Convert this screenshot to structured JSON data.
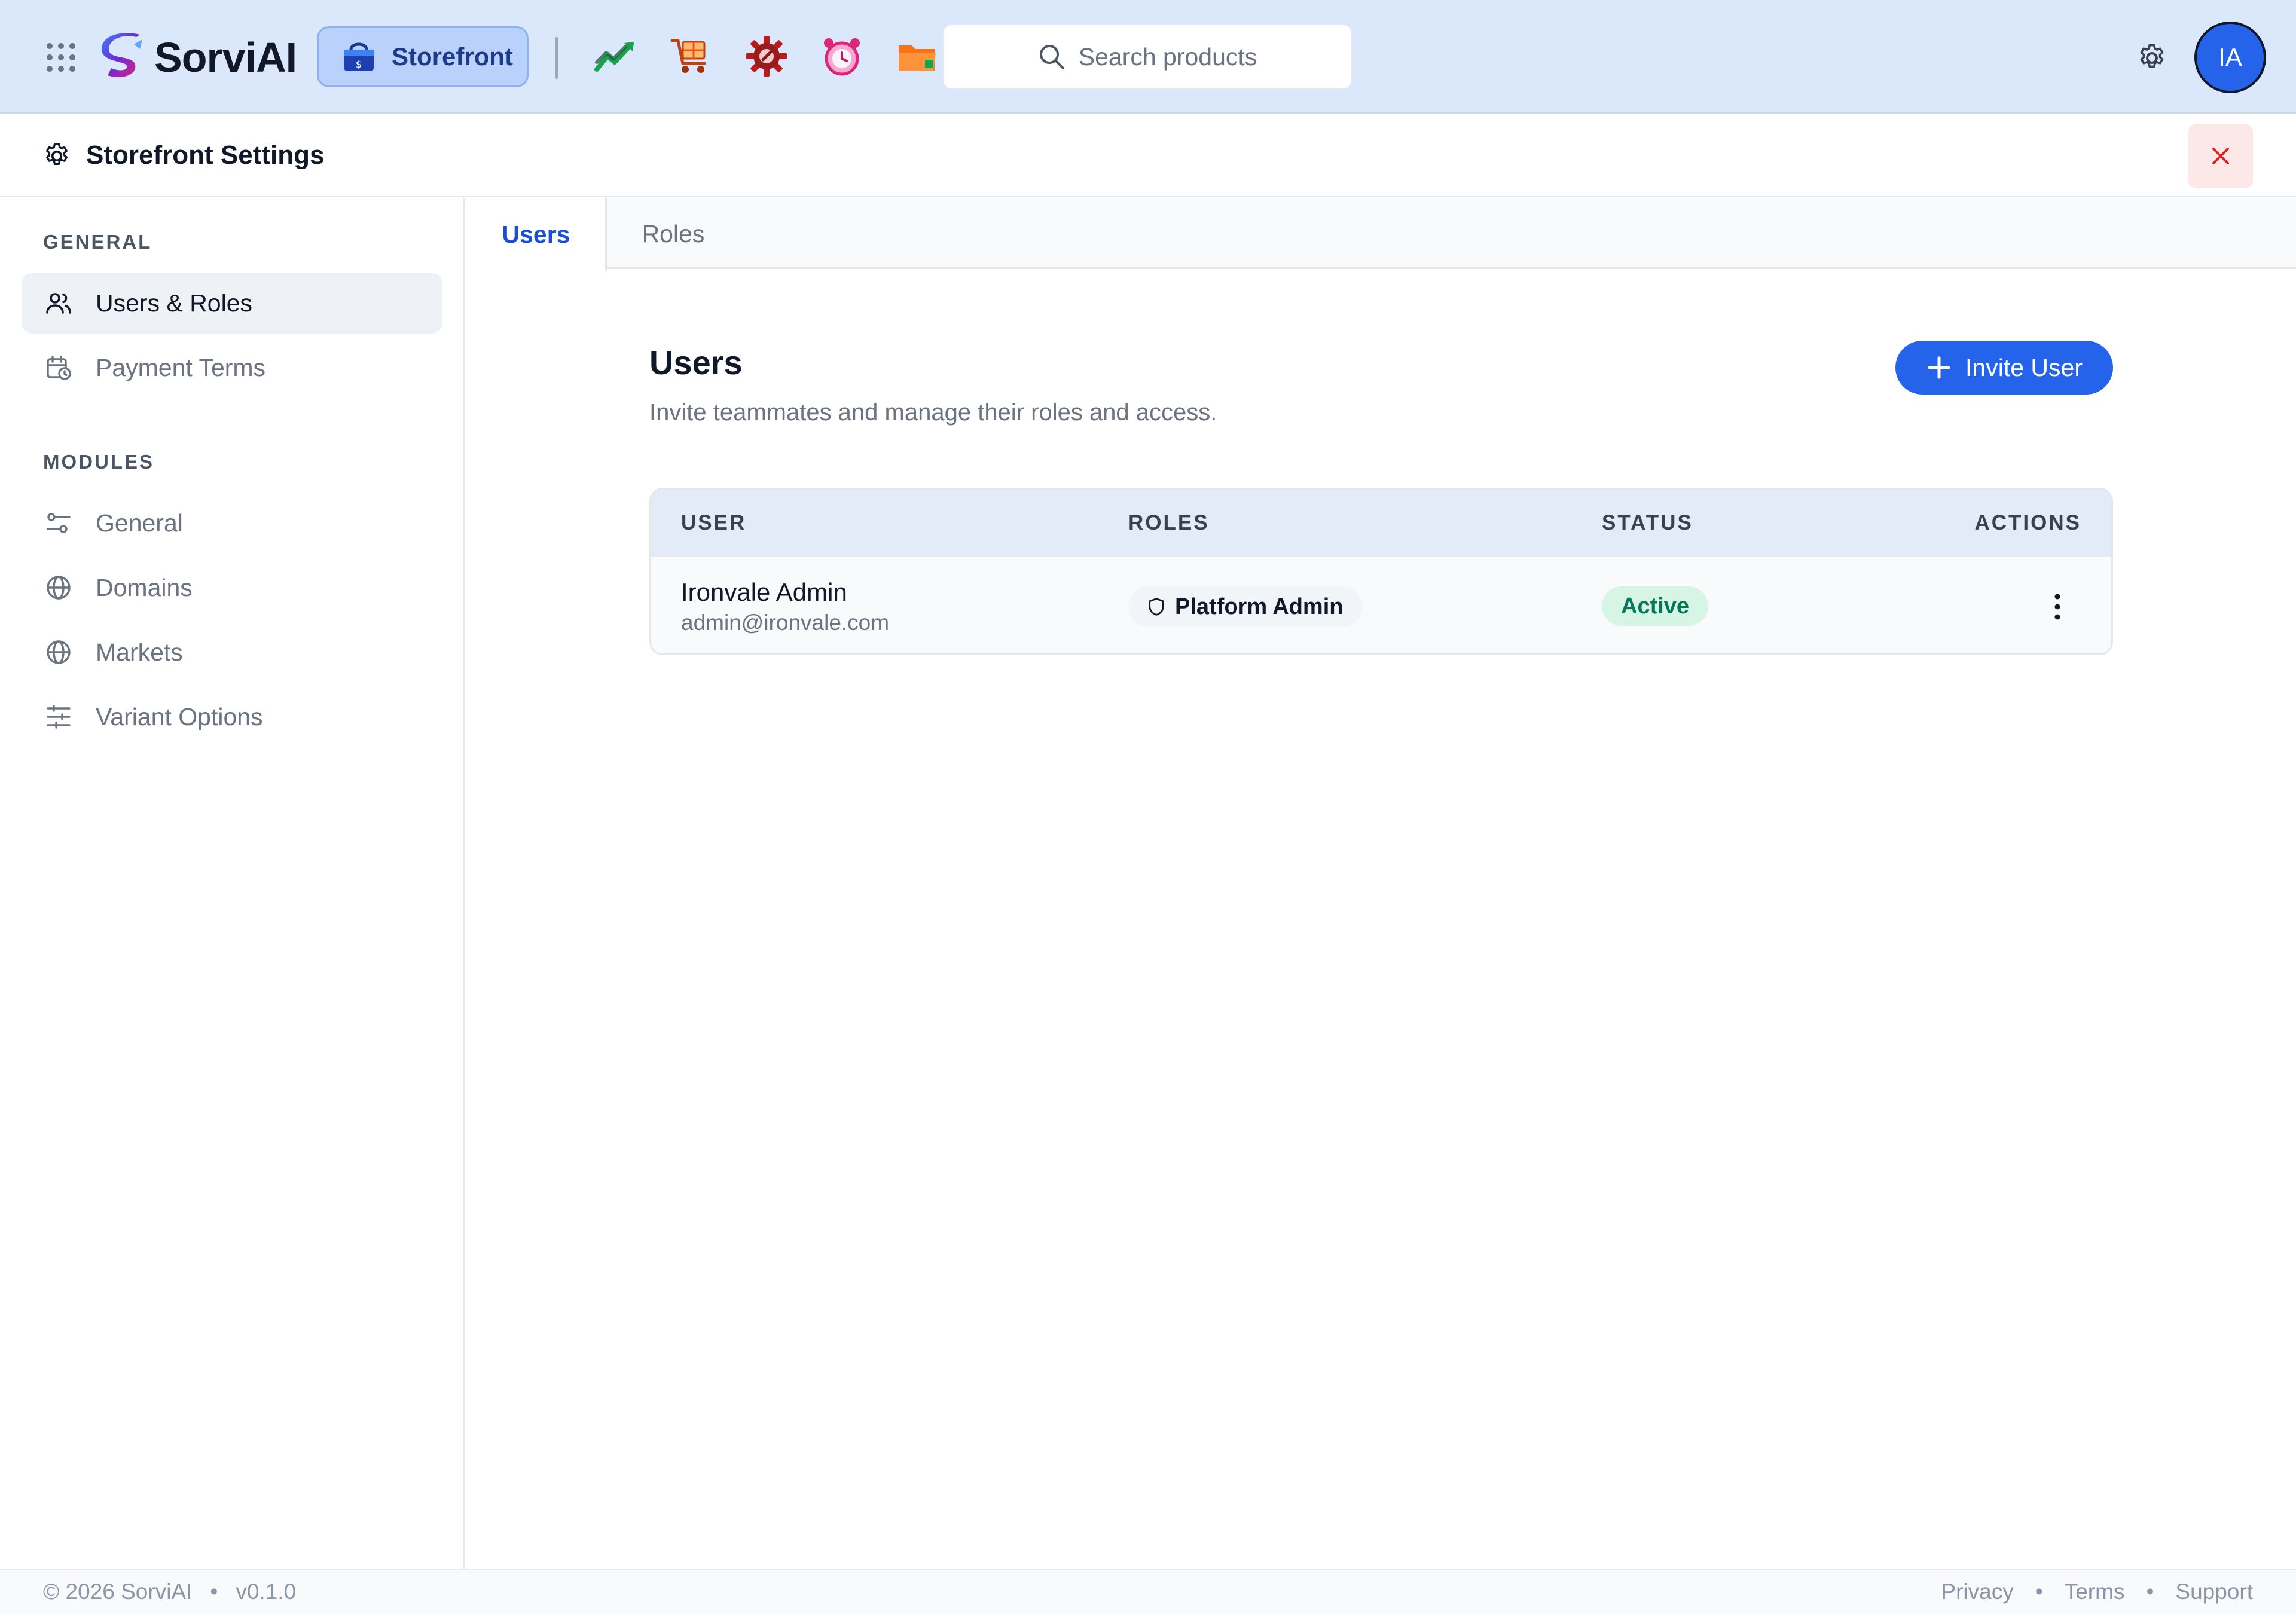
{
  "topbar": {
    "brand": "SorviAI",
    "current_app": "Storefront",
    "app_icons": [
      "analytics-icon",
      "cart-icon",
      "service-gear-icon",
      "alarm-clock-icon",
      "folder-icon"
    ],
    "search_placeholder": "Search products",
    "avatar_initials": "IA"
  },
  "settings_header": {
    "title": "Storefront Settings"
  },
  "sidebar": {
    "general_label": "GENERAL",
    "general_items": [
      {
        "label": "Users & Roles",
        "icon": "users-icon",
        "active": true
      },
      {
        "label": "Payment Terms",
        "icon": "calendar-clock-icon",
        "active": false
      }
    ],
    "modules_label": "MODULES",
    "modules_items": [
      {
        "label": "General",
        "icon": "toggles-icon"
      },
      {
        "label": "Domains",
        "icon": "globe-icon"
      },
      {
        "label": "Markets",
        "icon": "globe-icon"
      },
      {
        "label": "Variant Options",
        "icon": "sliders-icon"
      }
    ]
  },
  "tabs": [
    {
      "label": "Users",
      "active": true
    },
    {
      "label": "Roles",
      "active": false
    }
  ],
  "main": {
    "title": "Users",
    "subtitle": "Invite teammates and manage their roles and access.",
    "invite_label": "Invite User",
    "table": {
      "headers": [
        "USER",
        "ROLES",
        "STATUS",
        "ACTIONS"
      ],
      "rows": [
        {
          "name": "Ironvale Admin",
          "email": "admin@ironvale.com",
          "role": "Platform Admin",
          "status": "Active"
        }
      ]
    }
  },
  "footer": {
    "copyright": "© 2026 SorviAI",
    "version": "v0.1.0",
    "links": [
      "Privacy",
      "Terms",
      "Support"
    ],
    "separator": "•"
  },
  "colors": {
    "accent": "#2563eb",
    "topbar_bg": "#dbe8fb",
    "status_active_bg": "#d7f5e4",
    "status_active_text": "#047857",
    "close_bg": "#fde8e8"
  }
}
